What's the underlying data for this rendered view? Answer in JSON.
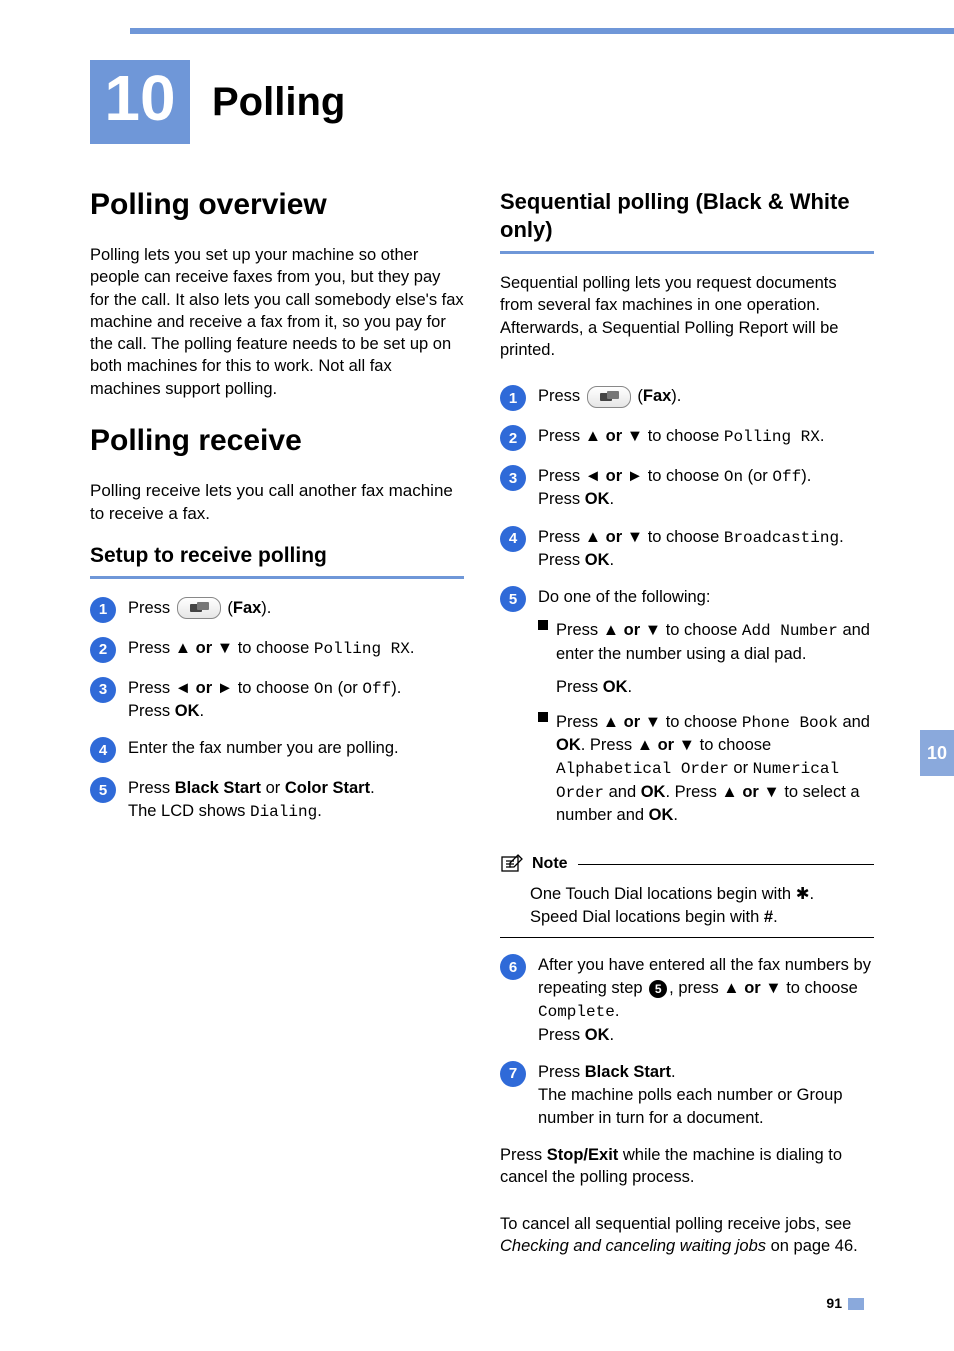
{
  "chapter": {
    "number": "10",
    "title": "Polling"
  },
  "side_tab": "10",
  "page_number": "91",
  "left": {
    "h1": "Polling overview",
    "p1": "Polling lets you set up your machine so other people can receive faxes from you, but they pay for the call. It also lets you call somebody else's fax machine and receive a fax from it, so you pay for the call. The polling feature needs to be set up on both machines for this to work. Not all fax machines support polling.",
    "h1b": "Polling receive",
    "p2": "Polling receive lets you call another fax machine to receive a fax.",
    "h2": "Setup to receive polling",
    "steps": [
      {
        "n": "1",
        "pre": "Press ",
        "post": " (",
        "bold": "Fax",
        "tail": ").",
        "has_btn": true
      },
      {
        "n": "2",
        "pre": "Press ",
        "arrows": "▲ or ▼",
        "mid": " to choose ",
        "mono": "Polling RX",
        "tail": "."
      },
      {
        "n": "3",
        "pre": "Press ",
        "arrows": "◄ or ►",
        "mid": " to choose ",
        "mono": "On",
        "mid2": " (or ",
        "mono2": "Off",
        "tail": ").",
        "line2_pre": "Press ",
        "line2_bold": "OK",
        "line2_tail": "."
      },
      {
        "n": "4",
        "text": "Enter the fax number you are polling."
      },
      {
        "n": "5",
        "pre": "Press ",
        "bold": "Black Start",
        "mid": " or ",
        "bold2": "Color Start",
        "tail": ".",
        "line2_pre": "The LCD shows ",
        "line2_mono": "Dialing",
        "line2_tail": "."
      }
    ]
  },
  "right": {
    "h2": "Sequential polling (Black & White only)",
    "p1": "Sequential polling lets you request documents from several fax machines in one operation. Afterwards, a Sequential Polling Report will be printed.",
    "steps": [
      {
        "n": "1",
        "pre": "Press ",
        "post": " (",
        "bold": "Fax",
        "tail": ").",
        "has_btn": true
      },
      {
        "n": "2",
        "pre": "Press ",
        "arrows": "▲ or ▼",
        "mid": " to choose ",
        "mono": "Polling RX",
        "tail": "."
      },
      {
        "n": "3",
        "pre": "Press ",
        "arrows": "◄ or ►",
        "mid": " to choose ",
        "mono": "On",
        "mid2": " (or ",
        "mono2": "Off",
        "tail": ").",
        "line2_pre": "Press ",
        "line2_bold": "OK",
        "line2_tail": "."
      },
      {
        "n": "4",
        "pre": "Press ",
        "arrows": "▲ or ▼",
        "mid": " to choose ",
        "mono": "Broadcasting",
        "tail": ".",
        "line2_pre": "Press ",
        "line2_bold": "OK",
        "line2_tail": "."
      },
      {
        "n": "5",
        "text": "Do one of the following:",
        "sub": [
          {
            "pre": "Press ",
            "arrows": "▲ or ▼",
            "mid": " to choose ",
            "mono": "Add Number",
            "tail": " and enter the number using a dial pad.",
            "line2_pre": "Press ",
            "line2_bold": "OK",
            "line2_tail": "."
          },
          {
            "pre": "Press ",
            "arrows": "▲ or ▼",
            "mid": " to choose ",
            "mono": "Phone Book",
            "mid2": " and ",
            "bold": "OK",
            "mid3": ". Press ",
            "arrows2": "▲ or ▼",
            "mid4": " to choose ",
            "mono2": "Alphabetical Order",
            "mid5": " or ",
            "mono3": "Numerical Order",
            "mid6": " and ",
            "bold2": "OK",
            "mid7": ". Press ",
            "arrows3": "▲ or ▼",
            "mid8": " to select a number and ",
            "bold3": "OK",
            "tail": "."
          }
        ]
      },
      {
        "n": "6",
        "pre": "After you have entered all the fax numbers by repeating step ",
        "inline_n": "5",
        "mid": ", press ",
        "arrows": "▲ or ▼",
        "mid2": " to choose ",
        "mono": "Complete",
        "tail": ".",
        "line2_pre": "Press ",
        "line2_bold": "OK",
        "line2_tail": "."
      },
      {
        "n": "7",
        "pre": "Press ",
        "bold": "Black Start",
        "tail": ".",
        "line2": "The machine polls each number or Group number in turn for a document."
      }
    ],
    "note": {
      "label": "Note",
      "line1_pre": "One Touch Dial locations begin with ",
      "line1_sym": "✱",
      "line1_tail": ".",
      "line2_pre": "Speed Dial locations begin with ",
      "line2_bold": "#",
      "line2_tail": "."
    },
    "after1_pre": "Press ",
    "after1_bold": "Stop/Exit",
    "after1_tail": " while the machine is dialing to cancel the polling process.",
    "after2_pre": "To cancel all sequential polling receive jobs, see ",
    "after2_italic": "Checking and canceling waiting jobs",
    "after2_tail": " on page 46."
  }
}
